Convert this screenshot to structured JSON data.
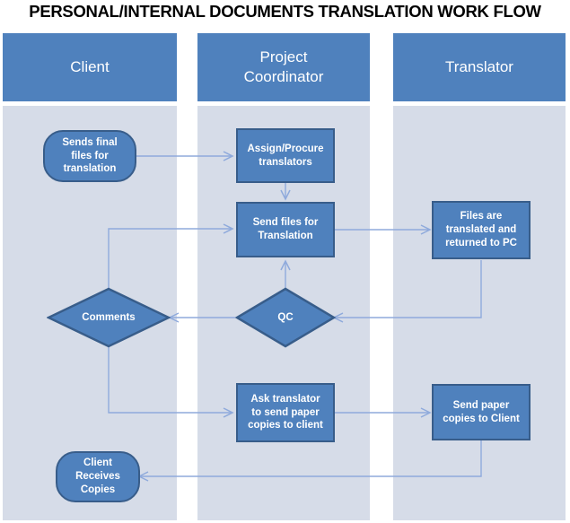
{
  "title": "PERSONAL/INTERNAL DOCUMENTS TRANSLATION WORK FLOW",
  "colors": {
    "node_fill": "#4f81bd",
    "node_border": "#385d8a",
    "lane_bg": "#d6dce8",
    "lane_header_fill": "#4f81bd",
    "connector": "#8faadc",
    "text_on_node": "#ffffff",
    "title_text": "#000000"
  },
  "lanes": [
    {
      "id": "client",
      "label": "Client"
    },
    {
      "id": "project-coordinator",
      "label": "Project\nCoordinator"
    },
    {
      "id": "translator",
      "label": "Translator"
    }
  ],
  "lane_labels": {
    "client": "Client",
    "project_coordinator_line1": "Project",
    "project_coordinator_line2": "Coordinator",
    "translator": "Translator"
  },
  "nodes": [
    {
      "id": "sends-final-files",
      "lane": "client",
      "shape": "rounded-rectangle",
      "lines": [
        "Sends final",
        "files for",
        "translation"
      ]
    },
    {
      "id": "assign-procure-translators",
      "lane": "project-coordinator",
      "shape": "rectangle",
      "lines": [
        "Assign/Procure",
        "translators"
      ]
    },
    {
      "id": "send-files-for-translation",
      "lane": "project-coordinator",
      "shape": "rectangle",
      "lines": [
        "Send files for",
        "Translation"
      ]
    },
    {
      "id": "files-translated-returned",
      "lane": "translator",
      "shape": "rectangle",
      "lines": [
        "Files are",
        "translated and",
        "returned to PC"
      ]
    },
    {
      "id": "comments",
      "lane": "client",
      "shape": "diamond",
      "lines": [
        "Comments"
      ]
    },
    {
      "id": "qc",
      "lane": "project-coordinator",
      "shape": "diamond",
      "lines": [
        "QC"
      ]
    },
    {
      "id": "ask-translator-paper-copies",
      "lane": "project-coordinator",
      "shape": "rectangle",
      "lines": [
        "Ask translator",
        "to send paper",
        "copies to client"
      ]
    },
    {
      "id": "send-paper-copies-to-client",
      "lane": "translator",
      "shape": "rectangle",
      "lines": [
        "Send paper",
        "copies to Client"
      ]
    },
    {
      "id": "client-receives-copies",
      "lane": "client",
      "shape": "rounded-rectangle",
      "lines": [
        "Client",
        "Receives",
        "Copies"
      ]
    }
  ],
  "node_text": {
    "sends_final_files_l1": "Sends final",
    "sends_final_files_l2": "files for",
    "sends_final_files_l3": "translation",
    "assign_procure_l1": "Assign/Procure",
    "assign_procure_l2": "translators",
    "send_files_l1": "Send files for",
    "send_files_l2": "Translation",
    "files_translated_l1": "Files are",
    "files_translated_l2": "translated and",
    "files_translated_l3": "returned to PC",
    "comments": "Comments",
    "qc": "QC",
    "ask_translator_l1": "Ask translator",
    "ask_translator_l2": "to send paper",
    "ask_translator_l3": "copies to client",
    "send_paper_l1": "Send paper",
    "send_paper_l2": "copies to Client",
    "client_receives_l1": "Client",
    "client_receives_l2": "Receives",
    "client_receives_l3": "Copies"
  },
  "connections": [
    {
      "from": "sends-final-files",
      "to": "assign-procure-translators"
    },
    {
      "from": "assign-procure-translators",
      "to": "send-files-for-translation"
    },
    {
      "from": "send-files-for-translation",
      "to": "files-translated-returned"
    },
    {
      "from": "files-translated-returned",
      "to": "qc"
    },
    {
      "from": "qc",
      "to": "comments"
    },
    {
      "from": "qc",
      "to": "send-files-for-translation"
    },
    {
      "from": "comments",
      "to": "send-files-for-translation"
    },
    {
      "from": "comments",
      "to": "ask-translator-paper-copies"
    },
    {
      "from": "ask-translator-paper-copies",
      "to": "send-paper-copies-to-client"
    },
    {
      "from": "send-paper-copies-to-client",
      "to": "client-receives-copies"
    }
  ]
}
